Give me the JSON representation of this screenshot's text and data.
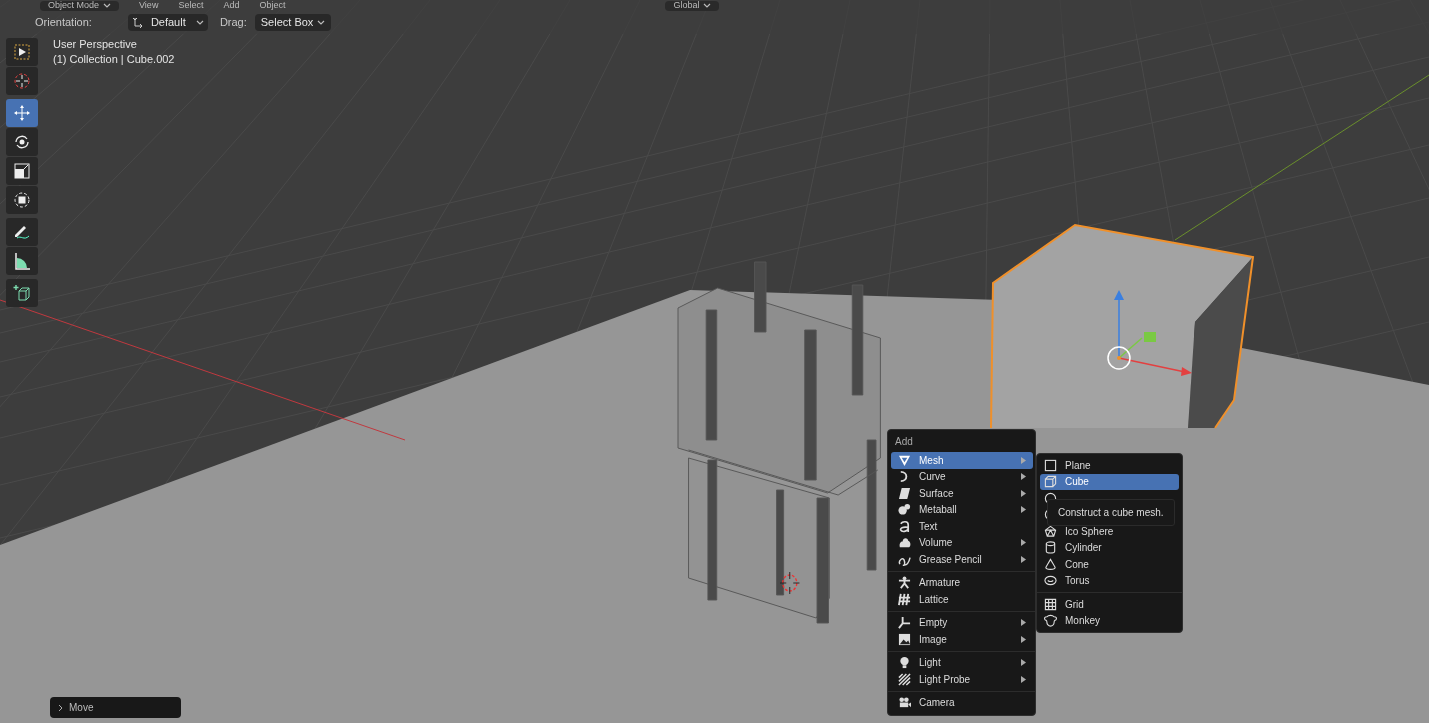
{
  "header": {
    "mode": "Object Mode",
    "menus": [
      "View",
      "Select",
      "Add",
      "Object"
    ],
    "orientation_dropdown": "Global"
  },
  "tool_settings": {
    "orientation_label": "Orientation:",
    "orientation": "Default",
    "drag_label": "Drag:",
    "drag": "Select Box"
  },
  "viewport": {
    "view_name": "User Perspective",
    "object_info": "(1) Collection | Cube.002"
  },
  "toolbar": [
    {
      "kind": "select",
      "selected": false
    },
    {
      "kind": "cursor",
      "selected": false
    },
    {
      "kind": "move",
      "selected": true
    },
    {
      "kind": "rotate",
      "selected": false
    },
    {
      "kind": "scale",
      "selected": false
    },
    {
      "kind": "transform",
      "selected": false
    },
    {
      "kind": "annotate",
      "selected": false
    },
    {
      "kind": "measure",
      "selected": false
    },
    {
      "kind": "add-cube",
      "selected": false
    }
  ],
  "add_menu": {
    "title": "Add",
    "items": [
      {
        "kind": "item",
        "label": "Mesh",
        "submenu": true,
        "selected": true
      },
      {
        "kind": "item",
        "label": "Curve",
        "submenu": true,
        "selected": false
      },
      {
        "kind": "item",
        "label": "Surface",
        "submenu": true,
        "selected": false
      },
      {
        "kind": "item",
        "label": "Metaball",
        "submenu": true,
        "selected": false
      },
      {
        "kind": "item",
        "label": "Text",
        "submenu": false,
        "selected": false
      },
      {
        "kind": "item",
        "label": "Volume",
        "submenu": true,
        "selected": false
      },
      {
        "kind": "item",
        "label": "Grease Pencil",
        "submenu": true,
        "selected": false
      },
      {
        "kind": "separator"
      },
      {
        "kind": "item",
        "label": "Armature",
        "submenu": false,
        "selected": false
      },
      {
        "kind": "item",
        "label": "Lattice",
        "submenu": false,
        "selected": false
      },
      {
        "kind": "separator"
      },
      {
        "kind": "item",
        "label": "Empty",
        "submenu": true,
        "selected": false
      },
      {
        "kind": "item",
        "label": "Image",
        "submenu": true,
        "selected": false
      },
      {
        "kind": "separator"
      },
      {
        "kind": "item",
        "label": "Light",
        "submenu": true,
        "selected": false
      },
      {
        "kind": "item",
        "label": "Light Probe",
        "submenu": true,
        "selected": false
      },
      {
        "kind": "separator"
      },
      {
        "kind": "item",
        "label": "Camera",
        "submenu": false,
        "selected": false
      }
    ]
  },
  "mesh_menu": {
    "items": [
      {
        "kind": "item",
        "label": "Plane",
        "selected": false
      },
      {
        "kind": "item",
        "label": "Cube",
        "selected": true
      },
      {
        "kind": "covered"
      },
      {
        "kind": "covered"
      },
      {
        "kind": "item",
        "label": "Ico Sphere",
        "selected": false
      },
      {
        "kind": "item",
        "label": "Cylinder",
        "selected": false
      },
      {
        "kind": "item",
        "label": "Cone",
        "selected": false
      },
      {
        "kind": "item",
        "label": "Torus",
        "selected": false
      },
      {
        "kind": "separator"
      },
      {
        "kind": "item",
        "label": "Grid",
        "selected": false
      },
      {
        "kind": "item",
        "label": "Monkey",
        "selected": false
      }
    ]
  },
  "tooltip": "Construct a cube mesh.",
  "last_operator": {
    "label": "Move",
    "expanded": false
  }
}
